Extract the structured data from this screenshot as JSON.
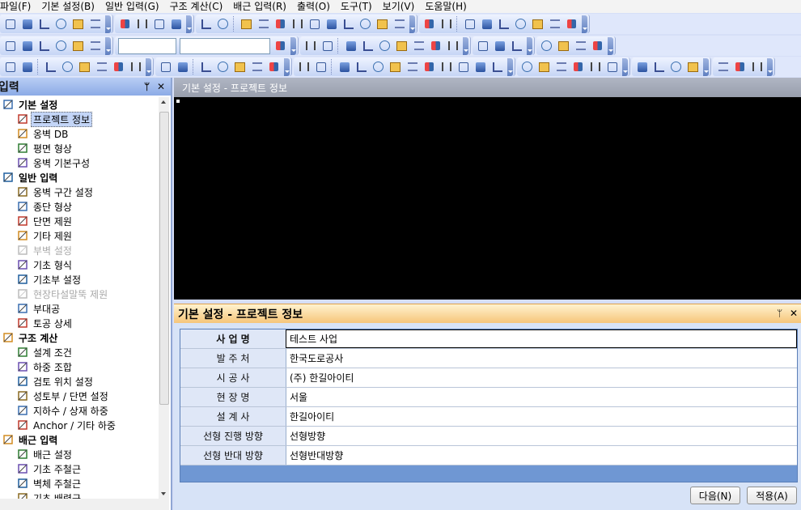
{
  "menu": [
    "파일(F)",
    "기본 설정(B)",
    "일반 입력(G)",
    "구조 계산(C)",
    "배근 입력(R)",
    "출력(O)",
    "도구(T)",
    "보기(V)",
    "도움말(H)"
  ],
  "toolbars": {
    "zoom_value": "",
    "layer_value": ""
  },
  "left_panel": {
    "title": "입력",
    "pin": "ᛘ",
    "close": "✕",
    "tree": [
      {
        "type": "cat",
        "label": "기본 설정",
        "icon": "edit-icon"
      },
      {
        "type": "item",
        "label": "프로젝트 정보",
        "icon": "project-info-icon",
        "selected": true
      },
      {
        "type": "item",
        "label": "옹벽 DB",
        "icon": "wall-db-icon"
      },
      {
        "type": "item",
        "label": "평면 형상",
        "icon": "plan-shape-icon"
      },
      {
        "type": "item",
        "label": "옹벽 기본구성",
        "icon": "wall-basic-icon"
      },
      {
        "type": "cat",
        "label": "일반 입력",
        "icon": "wall-input-icon"
      },
      {
        "type": "item",
        "label": "옹벽 구간 설정",
        "icon": "section-icon"
      },
      {
        "type": "item",
        "label": "종단 형상",
        "icon": "profile-icon"
      },
      {
        "type": "item",
        "label": "단면 제원",
        "icon": "cross-section-icon"
      },
      {
        "type": "item",
        "label": "기타 제원",
        "icon": "misc-dim-icon"
      },
      {
        "type": "item",
        "label": "부벽 설정",
        "icon": "buttress-icon",
        "disabled": true
      },
      {
        "type": "item",
        "label": "기초 형식",
        "icon": "foundation-type-icon"
      },
      {
        "type": "item",
        "label": "기초부 설정",
        "icon": "foundation-set-icon"
      },
      {
        "type": "item",
        "label": "현장타설말뚝 제원",
        "icon": "pile-icon",
        "disabled": true
      },
      {
        "type": "item",
        "label": "부대공",
        "icon": "auxiliary-icon"
      },
      {
        "type": "item",
        "label": "토공 상세",
        "icon": "earthwork-icon"
      },
      {
        "type": "cat",
        "label": "구조 계산",
        "icon": "calc-icon"
      },
      {
        "type": "item",
        "label": "설계 조건",
        "icon": "design-cond-icon"
      },
      {
        "type": "item",
        "label": "하중 조합",
        "icon": "load-combo-icon"
      },
      {
        "type": "item",
        "label": "검토 위치 설정",
        "icon": "check-pos-icon"
      },
      {
        "type": "item",
        "label": "성토부 / 단면 설정",
        "icon": "fill-section-icon"
      },
      {
        "type": "item",
        "label": "지하수 / 상재 하중",
        "icon": "groundwater-icon"
      },
      {
        "type": "item",
        "label": "Anchor / 기타 하중",
        "icon": "anchor-icon"
      },
      {
        "type": "cat",
        "label": "배근 입력",
        "icon": "rebar-input-icon"
      },
      {
        "type": "item",
        "label": "배근 설정",
        "icon": "rebar-set-icon"
      },
      {
        "type": "item",
        "label": "기초 주철근",
        "icon": "footing-rebar-icon"
      },
      {
        "type": "item",
        "label": "벽체 주철근",
        "icon": "wall-rebar-icon"
      },
      {
        "type": "item",
        "label": "기초 배력근",
        "icon": "dist-rebar-icon"
      }
    ]
  },
  "canvas": {
    "title": "기본 설정 - 프로젝트 정보"
  },
  "dialog": {
    "title": "기본 설정 - 프로젝트 정보",
    "pin": "ᛘ",
    "close": "✕",
    "rows": [
      {
        "label": "사 업 명",
        "value": "테스트 사업",
        "active": true
      },
      {
        "label": "발 주 처",
        "value": "한국도로공사"
      },
      {
        "label": "시 공 사",
        "value": "(주) 한길아이티"
      },
      {
        "label": "현 장 명",
        "value": "서울"
      },
      {
        "label": "설 계 사",
        "value": "한길아이티"
      },
      {
        "label": "선형 진행 방향",
        "value": "선형방향"
      },
      {
        "label": "선형 반대 방향",
        "value": "선형반대방향"
      }
    ],
    "next_label": "다음(N)",
    "apply_label": "적용(A)"
  },
  "colors": {
    "accent": "#6f97d3",
    "header": "#f6c57a",
    "panel_header": "#8cabe6"
  }
}
